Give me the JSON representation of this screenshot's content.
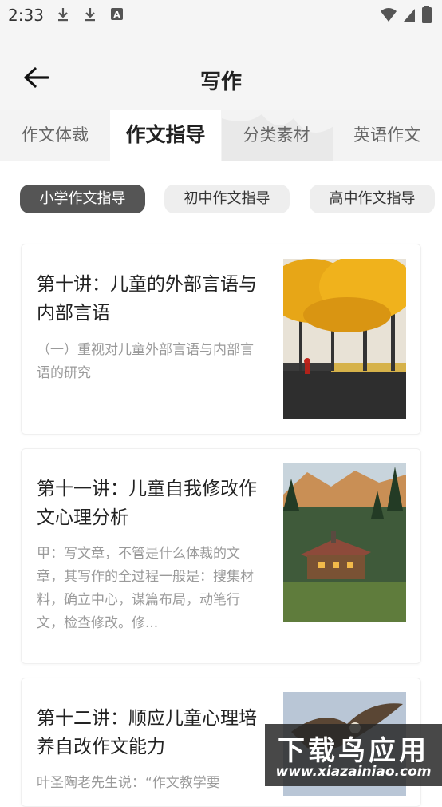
{
  "status_bar": {
    "time": "2:33",
    "left_icons": [
      "download-icon",
      "download-icon",
      "font-a-icon"
    ],
    "right_icons": [
      "wifi-icon",
      "signal-icon",
      "battery-icon"
    ]
  },
  "header": {
    "back_icon": "arrow-left-icon",
    "title": "写作"
  },
  "tabs": [
    {
      "label": "作文体裁",
      "active": false
    },
    {
      "label": "作文指导",
      "active": true
    },
    {
      "label": "分类素材",
      "active": false
    },
    {
      "label": "英语作文",
      "active": false
    }
  ],
  "chips": [
    {
      "label": "小学作文指导",
      "active": true
    },
    {
      "label": "初中作文指导",
      "active": false
    },
    {
      "label": "高中作文指导",
      "active": false
    }
  ],
  "articles": [
    {
      "title": "第十讲：儿童的外部言语与内部言语",
      "description": "（一）重视对儿童外部言语与内部言语的研究",
      "image": "autumn-trees-image"
    },
    {
      "title": "第十一讲：儿童自我修改作文心理分析",
      "description": "甲：写文章，不管是什么体裁的文章，其写作的全过程一般是：搜集材料，确立中心，谋篇布局，动笔行文，检查修改。修...",
      "image": "log-cabin-image"
    },
    {
      "title": "第十二讲：顺应儿童心理培养自改作文能力",
      "description": "叶圣陶老先生说：“作文教学要",
      "image": "bird-image"
    }
  ],
  "watermark": {
    "line1": "下载鸟应用",
    "line2": "www.xiazainiao.com"
  },
  "colors": {
    "header_bg": "#f5f5f5",
    "chip_active_bg": "#555555",
    "chip_bg": "#eeeeee",
    "desc_text": "#9a9a9a"
  }
}
